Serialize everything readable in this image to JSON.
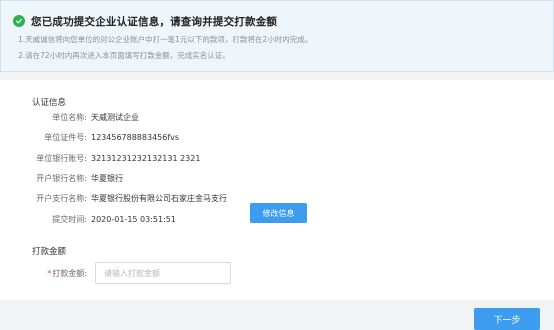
{
  "notice": {
    "title": "您已成功提交企业认证信息，请查询并提交打款金额",
    "lines": [
      "1.天威诚信将向您单位的对公企业账户中打一笔1元以下的款项，打款将在2小时内完成。",
      "2.请在72小时内再次进入本页面填写打款金额，完成实名认证。"
    ],
    "status_color": "#2bb24c"
  },
  "auth_info": {
    "title": "认证信息",
    "fields": [
      {
        "label": "单位名称:",
        "value": "天威测试企业"
      },
      {
        "label": "单位证件号:",
        "value": "123456788883456fvs"
      },
      {
        "label": "单位银行账号:",
        "value": "32131231232132131 2321"
      },
      {
        "label": "开户银行名称:",
        "value": "华夏银行"
      },
      {
        "label": "开户支行名称:",
        "value": "华夏银行股份有限公司石家庄金马支行"
      },
      {
        "label": "提交时间:",
        "value": "2020-01-15 03:51:51"
      }
    ],
    "edit_button": "修改信息"
  },
  "payment": {
    "title": "打款金额",
    "required_mark": "*",
    "label": "打款金额:",
    "value": "",
    "placeholder": "请输入打款金额"
  },
  "footer": {
    "next_button": "下一步"
  },
  "colors": {
    "primary": "#3b9cf0",
    "notice_bg": "#eef6fc",
    "page_bg": "#f2f3f5",
    "required": "#e64242"
  }
}
